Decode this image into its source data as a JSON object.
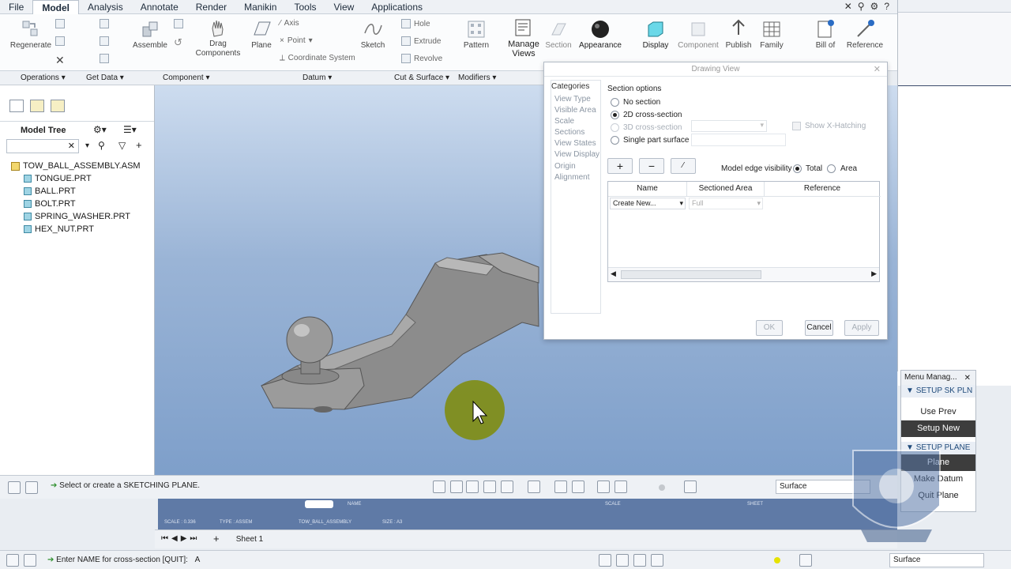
{
  "menu": {
    "tabs": [
      "File",
      "Model",
      "Analysis",
      "Annotate",
      "Render",
      "Manikin",
      "Tools",
      "View",
      "Applications"
    ],
    "active": "Model"
  },
  "ribbon": {
    "regenerate": "Regenerate",
    "assemble": "Assemble",
    "drag_components": "Drag\nComponents",
    "plane": "Plane",
    "axis": "Axis",
    "point": "Point",
    "coordinate_system": "Coordinate System",
    "sketch": "Sketch",
    "hole": "Hole",
    "extrude": "Extrude",
    "revolve": "Revolve",
    "pattern": "Pattern",
    "manage_views": "Manage\nViews",
    "section": "Section",
    "appearance": "Appearance",
    "display": "Display",
    "component": "Component",
    "publish": "Publish",
    "family": "Family",
    "bill_of": "Bill of",
    "reference": "Reference"
  },
  "groups": [
    "Operations",
    "Get Data",
    "Component",
    "Datum",
    "Cut & Surface",
    "Modifiers"
  ],
  "model_tree": {
    "title": "Model Tree",
    "assembly": "TOW_BALL_ASSEMBLY.ASM",
    "parts": [
      "TONGUE.PRT",
      "BALL.PRT",
      "BOLT.PRT",
      "SPRING_WASHER.PRT",
      "HEX_NUT.PRT"
    ]
  },
  "dialog": {
    "title": "Drawing View",
    "categories_header": "Categories",
    "categories": [
      "View Type",
      "Visible Area",
      "Scale",
      "Sections",
      "View States",
      "View Display",
      "Origin",
      "Alignment"
    ],
    "section_options_label": "Section options",
    "options": [
      "No section",
      "2D cross-section",
      "3D cross-section",
      "Single part surface"
    ],
    "selected_option": "2D cross-section",
    "show_xhatching": "Show X-Hatching",
    "edge_visibility_label": "Model edge visibility",
    "edge_total": "Total",
    "edge_area": "Area",
    "columns": [
      "Name",
      "Sectioned Area",
      "Reference"
    ],
    "row_name": "Create New...",
    "row_area": "Full",
    "ok": "OK",
    "cancel": "Cancel",
    "apply": "Apply"
  },
  "status": {
    "message": "Select or create a SKETCHING PLANE.",
    "filter": "Surface"
  },
  "draw_strip": {
    "name": "NAME",
    "name_value": "TOW_BALL_ASSEMBLY",
    "scale": "SCALE",
    "scale_value": "SCALE : 0.336",
    "type": "TYPE : ASSEM",
    "size": "SIZE : A3",
    "sheet": "SHEET"
  },
  "sheet_tab": "Sheet 1",
  "bottom": {
    "message": "Enter NAME for cross-section [QUIT]:",
    "input": "A",
    "filter": "Surface"
  },
  "menu_manager": {
    "title": "Menu Manag...",
    "section1": "SETUP SK PLN",
    "items1": [
      "Use Prev",
      "Setup New"
    ],
    "selected": "Setup New",
    "section2": "SETUP PLANE",
    "items2": [
      "Plane",
      "Make Datum",
      "Quit Plane"
    ]
  }
}
